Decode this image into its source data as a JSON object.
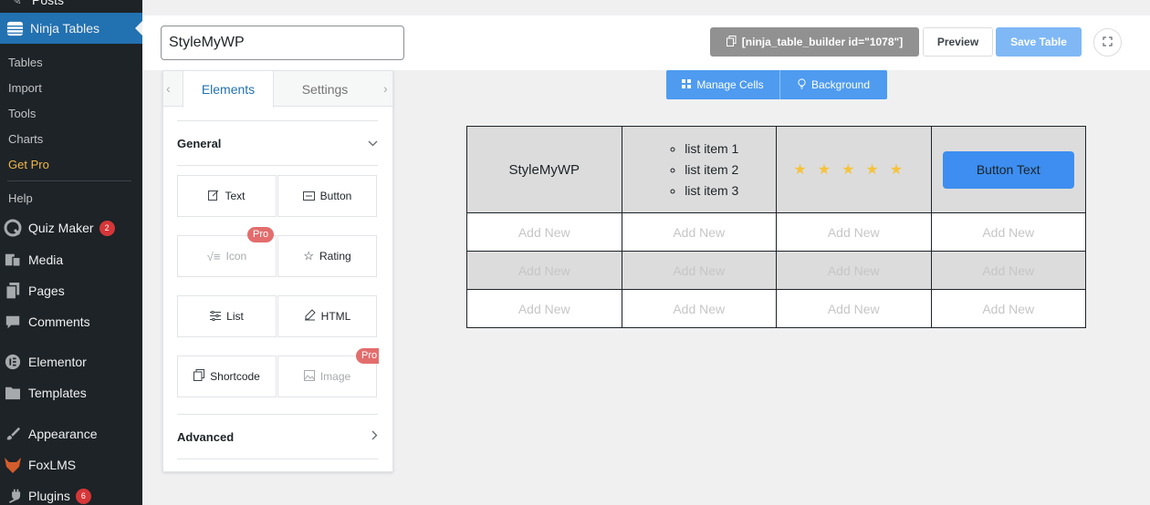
{
  "sidebar": {
    "top_cut_label": "Posts",
    "active": {
      "label": "Ninja Tables",
      "icon": "table-icon"
    },
    "submenu": [
      {
        "label": "Tables"
      },
      {
        "label": "Import"
      },
      {
        "label": "Tools"
      },
      {
        "label": "Charts"
      },
      {
        "label": "Get Pro"
      },
      {
        "label": "Help"
      }
    ],
    "items": [
      {
        "label": "Quiz Maker",
        "icon": "quiz-icon",
        "badge": "2"
      },
      {
        "label": "Media",
        "icon": "media-icon"
      },
      {
        "label": "Pages",
        "icon": "pages-icon"
      },
      {
        "label": "Comments",
        "icon": "comment-icon"
      },
      {
        "label": "Elementor",
        "icon": "elementor-icon"
      },
      {
        "label": "Templates",
        "icon": "folder-icon"
      },
      {
        "label": "Appearance",
        "icon": "brush-icon"
      },
      {
        "label": "FoxLMS",
        "icon": "fox-icon"
      },
      {
        "label": "Plugins",
        "icon": "plug-icon",
        "badge": "6"
      }
    ]
  },
  "header": {
    "table_title": "StyleMyWP",
    "shortcode": "[ninja_table_builder id=\"1078\"]",
    "preview_label": "Preview",
    "save_label": "Save Table"
  },
  "panel": {
    "tabs": [
      "Elements",
      "Settings"
    ],
    "general_label": "General",
    "advanced_label": "Advanced",
    "pro_label": "Pro",
    "elements": [
      {
        "label": "Text",
        "icon": "edit-icon",
        "pro": false
      },
      {
        "label": "Button",
        "icon": "button-icon",
        "pro": false
      },
      {
        "label": "Icon",
        "icon": "icon-icon",
        "pro": true
      },
      {
        "label": "Rating",
        "icon": "star-icon",
        "pro": false
      },
      {
        "label": "List",
        "icon": "list-icon",
        "pro": false
      },
      {
        "label": "HTML",
        "icon": "html-icon",
        "pro": false
      },
      {
        "label": "Shortcode",
        "icon": "shortcode-icon",
        "pro": false
      },
      {
        "label": "Image",
        "icon": "image-icon",
        "pro": true
      }
    ]
  },
  "toolbar": {
    "manage_cells_label": "Manage Cells",
    "background_label": "Background"
  },
  "table": {
    "header": {
      "text": "StyleMyWP",
      "list": [
        "list item 1",
        "list item 2",
        "list item 3"
      ],
      "rating_stars": 5,
      "button_text": "Button Text"
    },
    "placeholder": "Add New"
  },
  "colors": {
    "sidebar_bg": "#1d2327",
    "active_bg": "#2271b1",
    "accent": "#4e9bf0",
    "pro_badge": "#e36d6d",
    "star": "#f5c33b"
  }
}
